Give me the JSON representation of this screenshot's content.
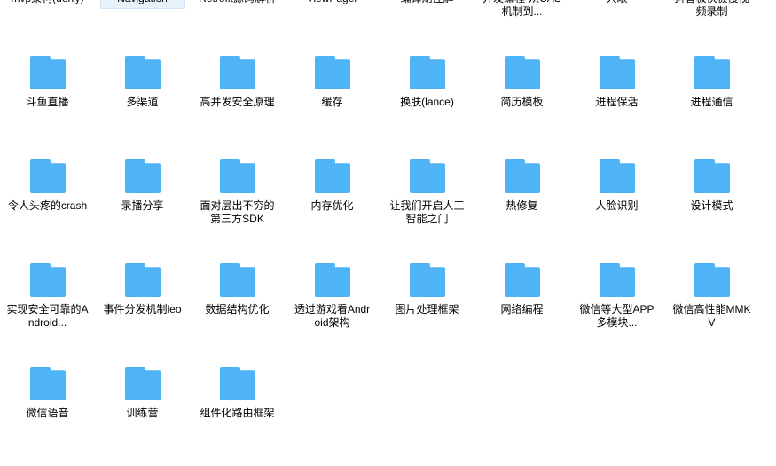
{
  "view": {
    "background_color": "#ffffff",
    "folder_icon_color": "#4fb4f7",
    "selection_fill_color": "#e8f2fb",
    "selection_border_color": "#cfe3f4",
    "label_text_color": "#000000",
    "icon_name": "folder-icon",
    "columns": 8
  },
  "rows": [
    {
      "items": [
        {
          "label": "mvp架构(derry)",
          "selected": false
        },
        {
          "label": "Navigation",
          "selected": true
        },
        {
          "label": "Retrofit源码解析",
          "selected": false
        },
        {
          "label": "ViewPager",
          "selected": false
        },
        {
          "label": "编译期注解",
          "selected": false
        },
        {
          "label": "并发编程-从CAS机制到...",
          "selected": false
        },
        {
          "label": "大眼",
          "selected": false
        },
        {
          "label": "抖音极快极慢视频录制",
          "selected": false
        }
      ]
    },
    {
      "items": [
        {
          "label": "斗鱼直播",
          "selected": false
        },
        {
          "label": "多渠道",
          "selected": false
        },
        {
          "label": "高并发安全原理",
          "selected": false
        },
        {
          "label": "缓存",
          "selected": false
        },
        {
          "label": "换肤(lance)",
          "selected": false
        },
        {
          "label": "简历模板",
          "selected": false
        },
        {
          "label": "进程保活",
          "selected": false
        },
        {
          "label": "进程通信",
          "selected": false
        }
      ]
    },
    {
      "items": [
        {
          "label": "令人头疼的crash",
          "selected": false
        },
        {
          "label": "录播分享",
          "selected": false
        },
        {
          "label": "面对层出不穷的第三方SDK",
          "selected": false
        },
        {
          "label": "内存优化",
          "selected": false
        },
        {
          "label": "让我们开启人工智能之门",
          "selected": false
        },
        {
          "label": "热修复",
          "selected": false
        },
        {
          "label": "人脸识别",
          "selected": false
        },
        {
          "label": "设计模式",
          "selected": false
        }
      ]
    },
    {
      "items": [
        {
          "label": "实现安全可靠的Android...",
          "selected": false
        },
        {
          "label": "事件分发机制leo",
          "selected": false
        },
        {
          "label": "数据结构优化",
          "selected": false
        },
        {
          "label": "透过游戏看Android架构",
          "selected": false
        },
        {
          "label": "图片处理框架",
          "selected": false
        },
        {
          "label": "网络编程",
          "selected": false
        },
        {
          "label": "微信等大型APP多模块...",
          "selected": false
        },
        {
          "label": "微信高性能MMKV",
          "selected": false
        }
      ]
    },
    {
      "items": [
        {
          "label": "微信语音",
          "selected": false
        },
        {
          "label": "训练营",
          "selected": false
        },
        {
          "label": "组件化路由框架",
          "selected": false
        }
      ]
    }
  ]
}
